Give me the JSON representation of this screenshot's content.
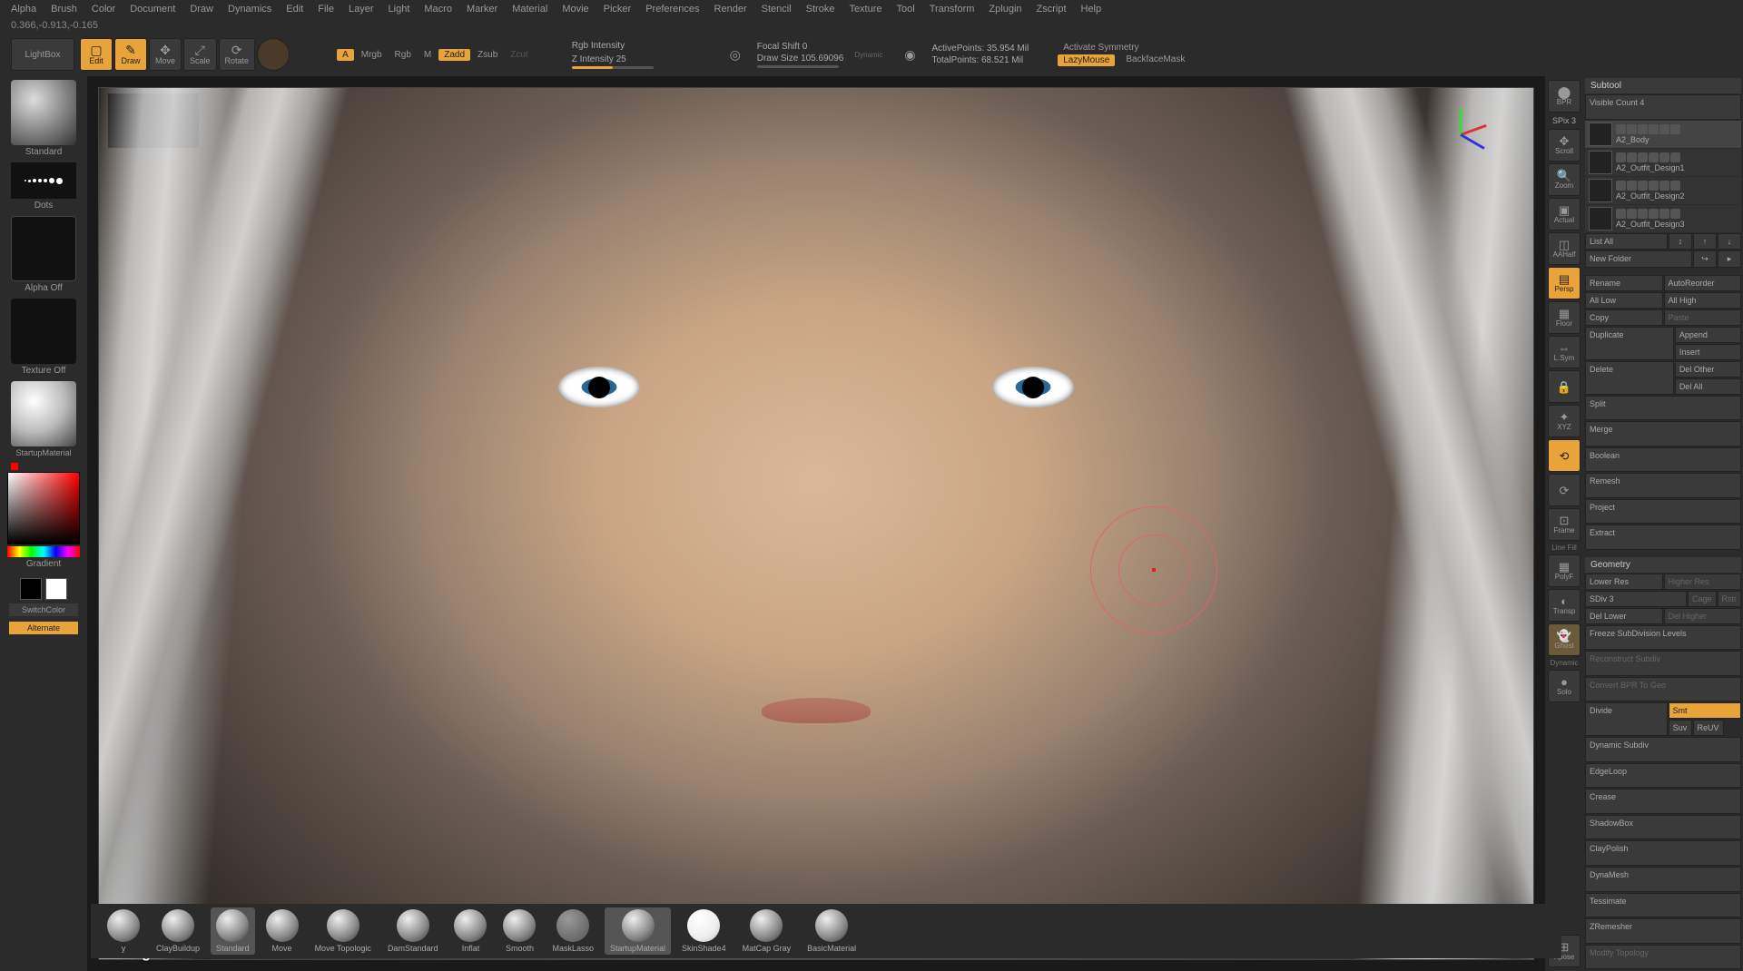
{
  "menu": [
    "Alpha",
    "Brush",
    "Color",
    "Document",
    "Draw",
    "Dynamics",
    "Edit",
    "File",
    "Layer",
    "Light",
    "Macro",
    "Marker",
    "Material",
    "Movie",
    "Picker",
    "Preferences",
    "Render",
    "Stencil",
    "Stroke",
    "Texture",
    "Tool",
    "Transform",
    "Zplugin",
    "Zscript",
    "Help"
  ],
  "coords": "0.366,-0.913,-0.165",
  "toolbar": {
    "lightbox": "LightBox",
    "edit": "Edit",
    "draw": "Draw",
    "move": "Move",
    "scale": "Scale",
    "rotate": "Rotate",
    "a": "A",
    "mrgb": "Mrgb",
    "rgb": "Rgb",
    "m": "M",
    "zadd": "Zadd",
    "zsub": "Zsub",
    "zcut": "Zcut",
    "rgb_intensity": "Rgb Intensity",
    "z_intensity": "Z Intensity 25",
    "focal_shift": "Focal Shift 0",
    "draw_size": "Draw Size 105.69096",
    "dynamic": "Dynamic",
    "active_points": "ActivePoints: 35.954 Mil",
    "total_points": "TotalPoints: 68.521 Mil",
    "activate_symmetry": "Activate Symmetry",
    "lazymouse": "LazyMouse",
    "backface": "BackfaceMask"
  },
  "left": {
    "brush": "Standard",
    "stroke": "Dots",
    "alpha": "Alpha Off",
    "texture": "Texture Off",
    "material": "StartupMaterial",
    "gradient": "Gradient",
    "switch": "SwitchColor",
    "alternate": "Alternate"
  },
  "rail": {
    "bpr": "BPR",
    "spix": "SPix 3",
    "scroll": "Scroll",
    "zoom": "Zoom",
    "actual": "Actual",
    "aahalf": "AAHalf",
    "persp": "Persp",
    "floor": "Floor",
    "lsym": "L.Sym",
    "lock": "",
    "xyz": "XYZ",
    "rot": "",
    "frame": "Frame",
    "polyf": "PolyF",
    "transp": "Transp",
    "ghost": "Ghost",
    "solo": "Solo",
    "xpose": "Xpose",
    "linefill": "Line Fill",
    "dynamic": "Dynamic"
  },
  "right": {
    "subtool_hdr": "Subtool",
    "visible_count": "Visible Count 4",
    "subtools": [
      "A2_Body",
      "A2_Outfit_Design1",
      "A2_Outfit_Design2",
      "A2_Outfit_Design3"
    ],
    "list_all": "List All",
    "new_folder": "New Folder",
    "rename": "Rename",
    "auto_reorder": "AutoReorder",
    "all_low": "All Low",
    "all_high": "All High",
    "copy": "Copy",
    "paste": "Paste",
    "duplicate": "Duplicate",
    "append": "Append",
    "insert": "Insert",
    "delete": "Delete",
    "del_other": "Del Other",
    "del_all": "Del All",
    "split": "Split",
    "merge": "Merge",
    "boolean": "Boolean",
    "remesh": "Remesh",
    "project": "Project",
    "extract": "Extract",
    "geometry_hdr": "Geometry",
    "lower_res": "Lower Res",
    "higher_res": "Higher Res",
    "sdiv": "SDiv 3",
    "cage": "Cage",
    "rstr": "Rstr",
    "del_lower": "Del Lower",
    "del_higher": "Del Higher",
    "freeze_sub": "Freeze SubDivision Levels",
    "reconstruct": "Reconstruct Subdiv",
    "convert_bpr": "Convert BPR To Geo",
    "divide": "Divide",
    "smt": "Smt",
    "suv": "Suv",
    "reuv": "ReUV",
    "dynamic_subdiv": "Dynamic Subdiv",
    "edgeloop": "EdgeLoop",
    "crease": "Crease",
    "shadowbox": "ShadowBox",
    "claypolish": "ClayPolish",
    "dynamesh": "DynaMesh",
    "tessimate": "Tessimate",
    "zremesher": "ZRemesher",
    "modify_topo": "Modify Topology"
  },
  "brushes": [
    "y",
    "ClayBuildup",
    "Standard",
    "Move",
    "Move Topologic",
    "DamStandard",
    "Inflat",
    "Smooth",
    "MaskLasso",
    "StartupMaterial",
    "SkinShade4",
    "MatCap Gray",
    "BasicMaterial"
  ],
  "watermark": "www.cgmol.com"
}
